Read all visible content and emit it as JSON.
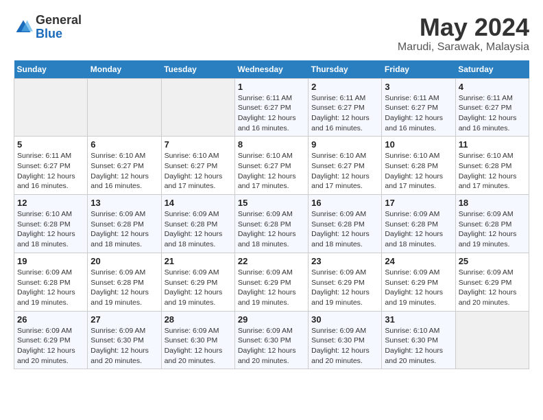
{
  "header": {
    "logo_general": "General",
    "logo_blue": "Blue",
    "month_title": "May 2024",
    "location": "Marudi, Sarawak, Malaysia"
  },
  "days_of_week": [
    "Sunday",
    "Monday",
    "Tuesday",
    "Wednesday",
    "Thursday",
    "Friday",
    "Saturday"
  ],
  "weeks": [
    [
      {
        "day": "",
        "info": ""
      },
      {
        "day": "",
        "info": ""
      },
      {
        "day": "",
        "info": ""
      },
      {
        "day": "1",
        "info": "Sunrise: 6:11 AM\nSunset: 6:27 PM\nDaylight: 12 hours\nand 16 minutes."
      },
      {
        "day": "2",
        "info": "Sunrise: 6:11 AM\nSunset: 6:27 PM\nDaylight: 12 hours\nand 16 minutes."
      },
      {
        "day": "3",
        "info": "Sunrise: 6:11 AM\nSunset: 6:27 PM\nDaylight: 12 hours\nand 16 minutes."
      },
      {
        "day": "4",
        "info": "Sunrise: 6:11 AM\nSunset: 6:27 PM\nDaylight: 12 hours\nand 16 minutes."
      }
    ],
    [
      {
        "day": "5",
        "info": "Sunrise: 6:11 AM\nSunset: 6:27 PM\nDaylight: 12 hours\nand 16 minutes."
      },
      {
        "day": "6",
        "info": "Sunrise: 6:10 AM\nSunset: 6:27 PM\nDaylight: 12 hours\nand 16 minutes."
      },
      {
        "day": "7",
        "info": "Sunrise: 6:10 AM\nSunset: 6:27 PM\nDaylight: 12 hours\nand 17 minutes."
      },
      {
        "day": "8",
        "info": "Sunrise: 6:10 AM\nSunset: 6:27 PM\nDaylight: 12 hours\nand 17 minutes."
      },
      {
        "day": "9",
        "info": "Sunrise: 6:10 AM\nSunset: 6:27 PM\nDaylight: 12 hours\nand 17 minutes."
      },
      {
        "day": "10",
        "info": "Sunrise: 6:10 AM\nSunset: 6:28 PM\nDaylight: 12 hours\nand 17 minutes."
      },
      {
        "day": "11",
        "info": "Sunrise: 6:10 AM\nSunset: 6:28 PM\nDaylight: 12 hours\nand 17 minutes."
      }
    ],
    [
      {
        "day": "12",
        "info": "Sunrise: 6:10 AM\nSunset: 6:28 PM\nDaylight: 12 hours\nand 18 minutes."
      },
      {
        "day": "13",
        "info": "Sunrise: 6:09 AM\nSunset: 6:28 PM\nDaylight: 12 hours\nand 18 minutes."
      },
      {
        "day": "14",
        "info": "Sunrise: 6:09 AM\nSunset: 6:28 PM\nDaylight: 12 hours\nand 18 minutes."
      },
      {
        "day": "15",
        "info": "Sunrise: 6:09 AM\nSunset: 6:28 PM\nDaylight: 12 hours\nand 18 minutes."
      },
      {
        "day": "16",
        "info": "Sunrise: 6:09 AM\nSunset: 6:28 PM\nDaylight: 12 hours\nand 18 minutes."
      },
      {
        "day": "17",
        "info": "Sunrise: 6:09 AM\nSunset: 6:28 PM\nDaylight: 12 hours\nand 18 minutes."
      },
      {
        "day": "18",
        "info": "Sunrise: 6:09 AM\nSunset: 6:28 PM\nDaylight: 12 hours\nand 19 minutes."
      }
    ],
    [
      {
        "day": "19",
        "info": "Sunrise: 6:09 AM\nSunset: 6:28 PM\nDaylight: 12 hours\nand 19 minutes."
      },
      {
        "day": "20",
        "info": "Sunrise: 6:09 AM\nSunset: 6:28 PM\nDaylight: 12 hours\nand 19 minutes."
      },
      {
        "day": "21",
        "info": "Sunrise: 6:09 AM\nSunset: 6:29 PM\nDaylight: 12 hours\nand 19 minutes."
      },
      {
        "day": "22",
        "info": "Sunrise: 6:09 AM\nSunset: 6:29 PM\nDaylight: 12 hours\nand 19 minutes."
      },
      {
        "day": "23",
        "info": "Sunrise: 6:09 AM\nSunset: 6:29 PM\nDaylight: 12 hours\nand 19 minutes."
      },
      {
        "day": "24",
        "info": "Sunrise: 6:09 AM\nSunset: 6:29 PM\nDaylight: 12 hours\nand 19 minutes."
      },
      {
        "day": "25",
        "info": "Sunrise: 6:09 AM\nSunset: 6:29 PM\nDaylight: 12 hours\nand 20 minutes."
      }
    ],
    [
      {
        "day": "26",
        "info": "Sunrise: 6:09 AM\nSunset: 6:29 PM\nDaylight: 12 hours\nand 20 minutes."
      },
      {
        "day": "27",
        "info": "Sunrise: 6:09 AM\nSunset: 6:30 PM\nDaylight: 12 hours\nand 20 minutes."
      },
      {
        "day": "28",
        "info": "Sunrise: 6:09 AM\nSunset: 6:30 PM\nDaylight: 12 hours\nand 20 minutes."
      },
      {
        "day": "29",
        "info": "Sunrise: 6:09 AM\nSunset: 6:30 PM\nDaylight: 12 hours\nand 20 minutes."
      },
      {
        "day": "30",
        "info": "Sunrise: 6:09 AM\nSunset: 6:30 PM\nDaylight: 12 hours\nand 20 minutes."
      },
      {
        "day": "31",
        "info": "Sunrise: 6:10 AM\nSunset: 6:30 PM\nDaylight: 12 hours\nand 20 minutes."
      },
      {
        "day": "",
        "info": ""
      }
    ]
  ]
}
